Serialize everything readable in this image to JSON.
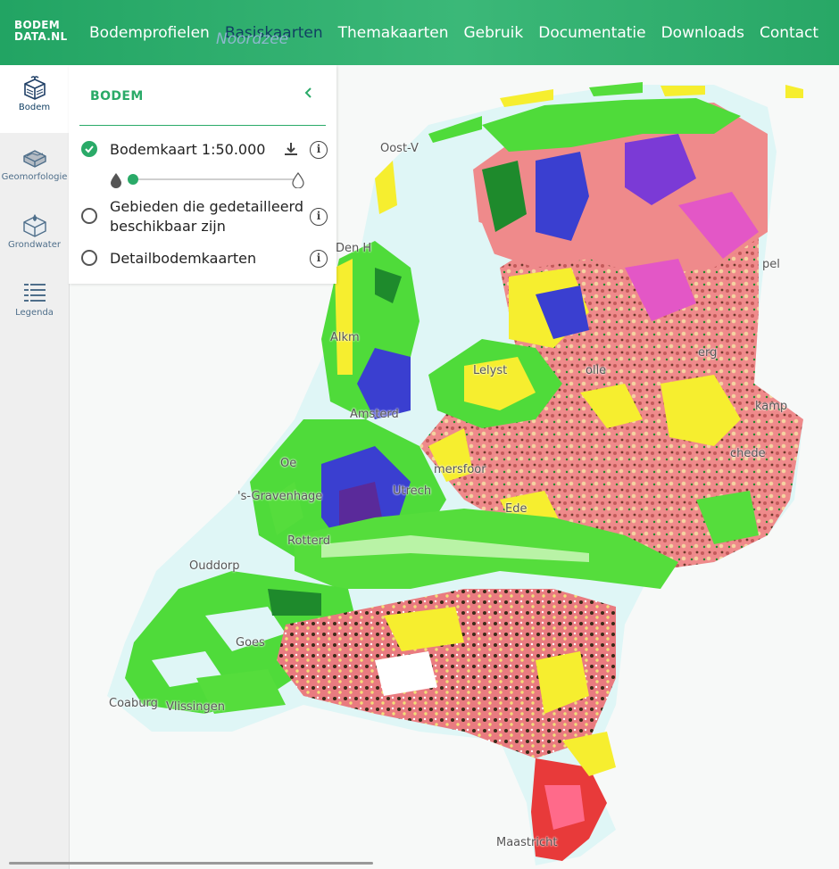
{
  "logo": {
    "line1": "BODEM",
    "line2": "DATA.NL"
  },
  "nav": {
    "items": [
      "Bodemprofielen",
      "Basiskaarten",
      "Themakaarten",
      "Gebruik",
      "Documentatie",
      "Downloads",
      "Contact"
    ],
    "active": "Basiskaarten"
  },
  "rail": {
    "items": [
      {
        "label": "Bodem",
        "icon": "soil-package-icon",
        "active": true
      },
      {
        "label": "Geomorfologie",
        "icon": "terrain-block-icon",
        "active": false
      },
      {
        "label": "Grondwater",
        "icon": "groundwater-cube-icon",
        "active": false
      },
      {
        "label": "Legenda",
        "icon": "legend-list-icon",
        "active": false
      }
    ]
  },
  "panel": {
    "title": "BODEM",
    "collapse_icon": "chevron-left-icon",
    "layers": [
      {
        "label": "Bodemkaart 1:50.000",
        "selected": true,
        "download": true,
        "opacity": 0.05
      },
      {
        "label_line1": "Gebieden die gedetailleerd",
        "label_line2": "beschikbaar zijn",
        "selected": false
      },
      {
        "label": "Detailbodemkaarten",
        "selected": false
      }
    ],
    "opacity_min_icon": "drop-filled-icon",
    "opacity_max_icon": "drop-outline-icon"
  },
  "map": {
    "sea_label": "Noordzee",
    "places": [
      "Oost-V",
      "Den H",
      "Alkm",
      "Lelyst",
      "Amsterd",
      "Oe",
      "'s-Gravenhage",
      "Utrech",
      "mersfoor",
      "Ede",
      "Rotterd",
      "Ouddorp",
      "Goes",
      "Coaburg",
      "Vlissingen",
      "Maastricht",
      "pel",
      "erg",
      "kamp",
      "chede",
      "olle"
    ]
  },
  "colors": {
    "brand_green": "#2aaa68",
    "nav_active": "#113f63",
    "sea": "#dff6f6",
    "soil_pink": "#f08a8a",
    "soil_green": "#55dd3c",
    "soil_blue": "#3a3fd0",
    "soil_yellow": "#f6ee2f"
  }
}
